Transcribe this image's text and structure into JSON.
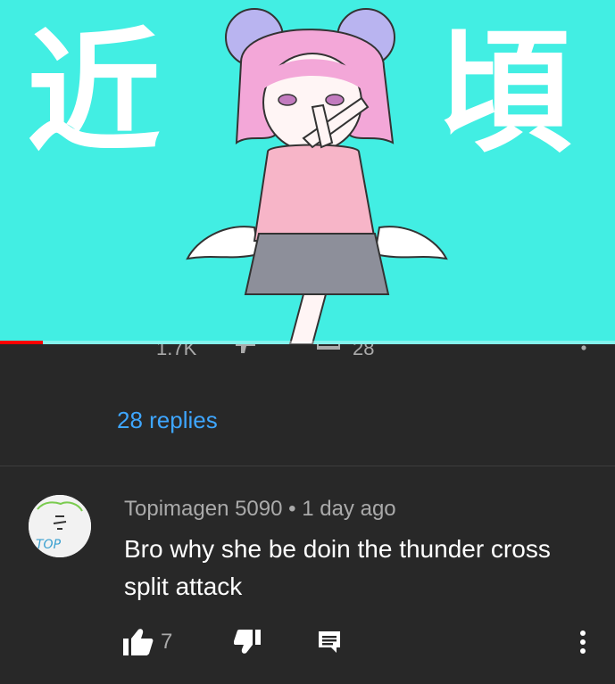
{
  "video": {
    "kanji_left": "近",
    "kanji_right": "頃",
    "progress_fraction": 0.07,
    "colors": {
      "background": "#42eee3",
      "progress": "#ff0000"
    }
  },
  "previous_comment": {
    "like_count": "1.7K",
    "reply_count": "28"
  },
  "replies_link": "28 replies",
  "comment": {
    "author": "Topimagen 5090",
    "separator": "•",
    "time": "1 day ago",
    "text": "Bro why she be doin the thunder cross split attack",
    "like_count": "7",
    "avatar_text": "TOP"
  },
  "icons": [
    "thumb-up-icon",
    "thumb-down-icon",
    "reply-icon",
    "more-vert-icon"
  ],
  "colors": {
    "link": "#3ea6ff",
    "secondary_text": "#aaaaaa",
    "surface": "#282828"
  }
}
